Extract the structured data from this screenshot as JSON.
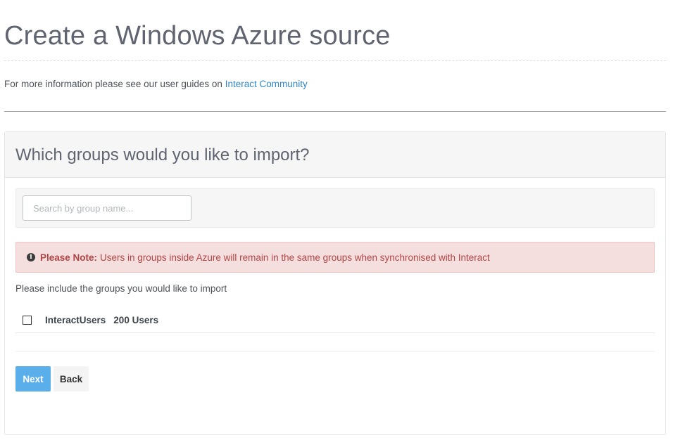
{
  "header": {
    "title": "Create a Windows Azure source",
    "info_text": "For more information please see our user guides on",
    "info_link": "Interact Community"
  },
  "panel": {
    "heading": "Which groups would you like to import?",
    "search": {
      "placeholder": "Search by group name...",
      "value": ""
    },
    "alert": {
      "icon": "info-icon",
      "strong": "Please Note:",
      "message": "Users in groups inside Azure will remain in the same groups when synchronised with Interact"
    },
    "include_label": "Please include the groups you would like to import",
    "groups": [
      {
        "name": "InteractUsers",
        "count": "200 Users",
        "checked": false
      }
    ],
    "buttons": {
      "next": "Next",
      "back": "Back"
    }
  },
  "colors": {
    "link": "#2f86c8",
    "primary_button": "#5aaeea",
    "alert_bg": "#f5dede",
    "alert_text": "#b14444"
  }
}
